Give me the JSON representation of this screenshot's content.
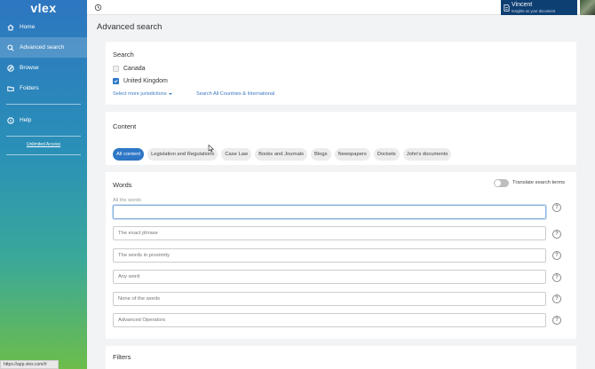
{
  "brand": {
    "logo": "vlex"
  },
  "sidebar": {
    "items": [
      {
        "label": "Home",
        "icon": "home-icon"
      },
      {
        "label": "Advanced search",
        "icon": "search-icon",
        "active": true
      },
      {
        "label": "Browse",
        "icon": "compass-icon"
      },
      {
        "label": "Folders",
        "icon": "folder-icon"
      },
      {
        "label": "Help",
        "icon": "help-circle-icon"
      }
    ],
    "unlimited": "Unlimited Access"
  },
  "statusbar": {
    "url": "https://app.vlex.com/#"
  },
  "topbar": {
    "user_name": "Vincent",
    "user_subtitle": "Insights on your document"
  },
  "page": {
    "title": "Advanced search"
  },
  "search_section": {
    "title": "Search",
    "jurisdictions": [
      {
        "label": "Canada",
        "checked": false
      },
      {
        "label": "United Kingdom",
        "checked": true
      }
    ],
    "select_more": "Select more jurisdictions",
    "search_all": "Search All Countries & International"
  },
  "content_section": {
    "title": "Content",
    "chips": [
      "All content",
      "Legislation and Regulations",
      "Case Law",
      "Books and Journals",
      "Blogs",
      "Newspapers",
      "Dockets",
      "John's documents"
    ],
    "active_index": 0
  },
  "words_section": {
    "title": "Words",
    "translate_label": "Translate search terms",
    "all_words_label": "All the words",
    "placeholders": [
      "The exact phrase",
      "The words in proximity",
      "Any word",
      "None of the words",
      "Advanced Operators"
    ],
    "help_glyph": "?"
  },
  "filters_section": {
    "title": "Filters"
  },
  "colors": {
    "accent": "#2d77c6",
    "nav_dark": "#0e3f73"
  }
}
